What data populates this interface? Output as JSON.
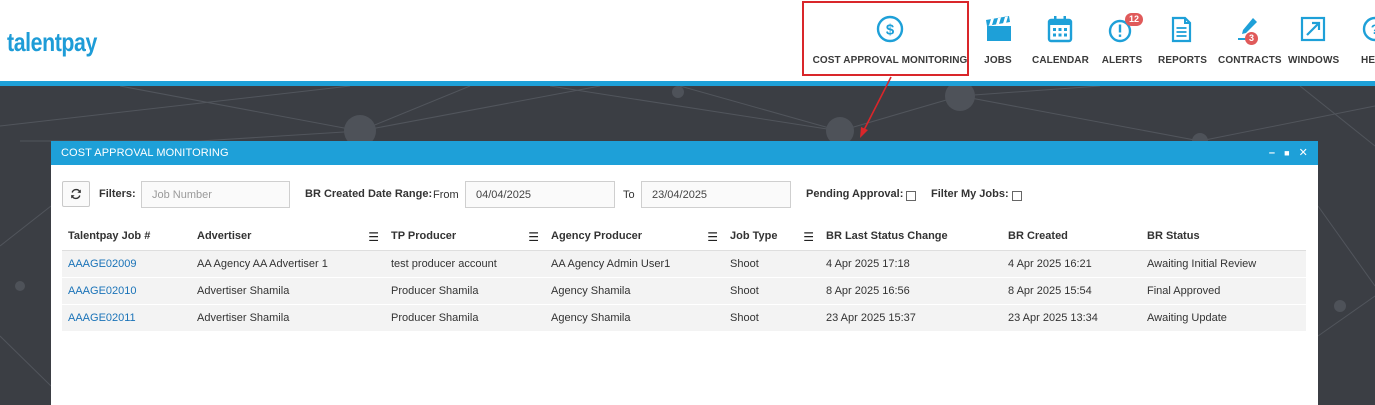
{
  "header": {
    "logo": "talentpay",
    "nav": [
      {
        "label": "COST APPROVAL MONITORING",
        "icon": "dollar-circle-icon",
        "badge": ""
      },
      {
        "label": "JOBS",
        "icon": "clapperboard-icon",
        "badge": ""
      },
      {
        "label": "CALENDAR",
        "icon": "calendar-icon",
        "badge": ""
      },
      {
        "label": "ALERTS",
        "icon": "alert-icon",
        "badge": "12"
      },
      {
        "label": "REPORTS",
        "icon": "report-document-icon",
        "badge": ""
      },
      {
        "label": "CONTRACTS",
        "icon": "contract-pen-icon",
        "badge": "3"
      },
      {
        "label": "WINDOWS",
        "icon": "windows-resize-icon",
        "badge": ""
      },
      {
        "label": "HE",
        "icon": "help-icon",
        "badge": ""
      }
    ],
    "accent_color": "#1ea0d8",
    "highlight_color": "#d9262a"
  },
  "modal": {
    "title": "COST APPROVAL MONITORING",
    "controls": {
      "minimize": "–",
      "maximize": "■",
      "close": "✕"
    },
    "filters": {
      "label": "Filters:",
      "job_number_placeholder": "Job Number",
      "date_range_label": "BR Created Date Range:",
      "from_label": "From",
      "from_value": "04/04/2025",
      "to_label": "To",
      "to_value": "23/04/2025",
      "pending_label": "Pending Approval:",
      "my_jobs_label": "Filter My Jobs:"
    },
    "table": {
      "columns": [
        "Talentpay Job #",
        "Advertiser",
        "TP Producer",
        "Agency Producer",
        "Job Type",
        "BR Last Status Change",
        "BR Created",
        "BR Status"
      ],
      "rows": [
        [
          "AAAGE02009",
          "AA Agency AA Advertiser 1",
          "test producer account",
          "AA Agency Admin User1",
          "Shoot",
          "4 Apr 2025 17:18",
          "4 Apr 2025 16:21",
          "Awaiting Initial Review"
        ],
        [
          "AAAGE02010",
          "Advertiser Shamila",
          "Producer Shamila",
          "Agency Shamila",
          "Shoot",
          "8 Apr 2025 16:56",
          "8 Apr 2025 15:54",
          "Final Approved"
        ],
        [
          "AAAGE02011",
          "Advertiser Shamila",
          "Producer Shamila",
          "Agency Shamila",
          "Shoot",
          "23 Apr 2025 15:37",
          "23 Apr 2025 13:34",
          "Awaiting Update"
        ]
      ]
    }
  }
}
